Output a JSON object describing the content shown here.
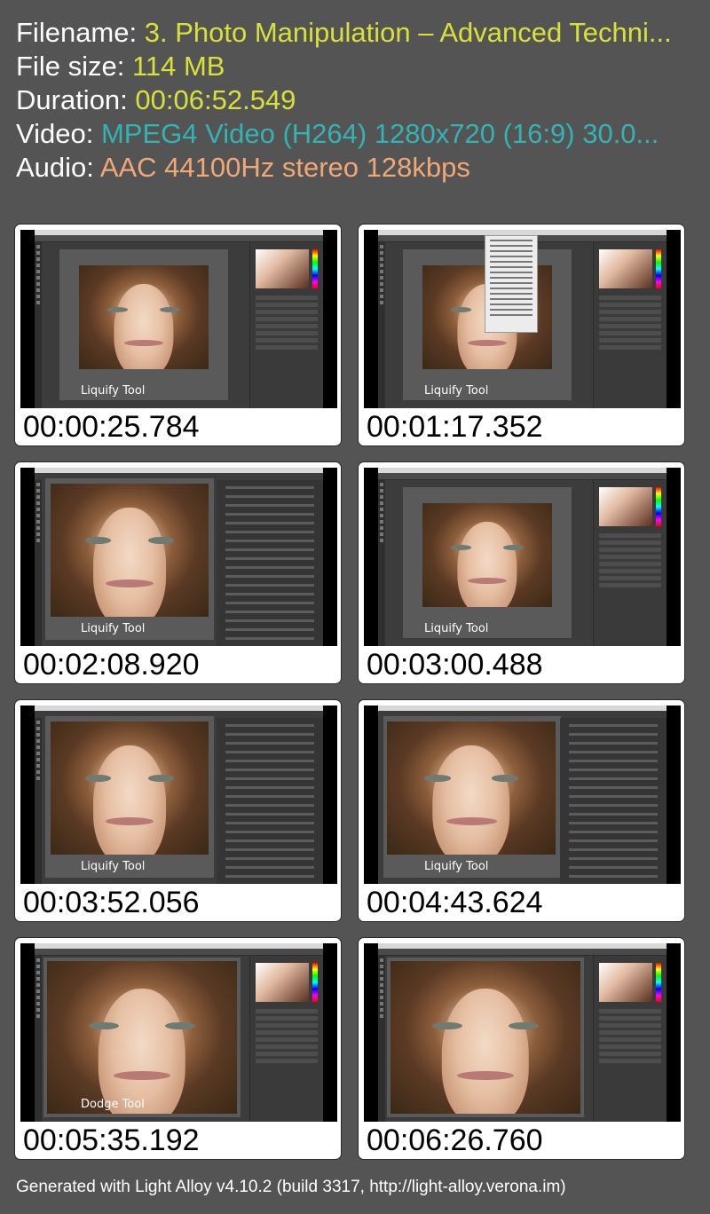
{
  "info": {
    "filename_label": "Filename:",
    "filename_value": "3. Photo Manipulation – Advanced Techni...",
    "filesize_label": "File size:",
    "filesize_value": "114 MB",
    "duration_label": "Duration:",
    "duration_value": "00:06:52.549",
    "video_label": "Video:",
    "video_value": "MPEG4 Video (H264) 1280x720 (16:9) 30.0...",
    "audio_label": "Audio:",
    "audio_value": "AAC 44100Hz stereo 128kbps"
  },
  "thumbnails": [
    {
      "caption": "Liquify Tool",
      "timecode": "00:00:25.784"
    },
    {
      "caption": "Liquify Tool",
      "timecode": "00:01:17.352"
    },
    {
      "caption": "Liquify Tool",
      "timecode": "00:02:08.920"
    },
    {
      "caption": "Liquify Tool",
      "timecode": "00:03:00.488"
    },
    {
      "caption": "Liquify Tool",
      "timecode": "00:03:52.056"
    },
    {
      "caption": "Liquify Tool",
      "timecode": "00:04:43.624"
    },
    {
      "caption": "Dodge Tool",
      "timecode": "00:05:35.192"
    },
    {
      "caption": "",
      "timecode": "00:06:26.760"
    }
  ],
  "footer": "Generated with Light Alloy v4.10.2 (build 3317, http://light-alloy.verona.im)",
  "colors": {
    "background": "#545454",
    "value_yellow": "#d9e03a",
    "value_cyan": "#33b3b3",
    "value_orange": "#f0a878"
  }
}
